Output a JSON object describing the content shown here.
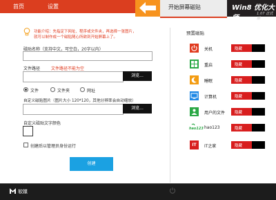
{
  "nav": {
    "home": "首页",
    "settings": "设置"
  },
  "tab": {
    "start_screen": "开始屏幕磁贴"
  },
  "product": {
    "name": "Win8 优化大师",
    "version": "1.07 正式版"
  },
  "intro": {
    "line1": "功能介绍：先指定下网址、程序或文件夹，再选择一张图片，",
    "line2": "就可以制作成一个磁贴随心所欲到开始屏幕上了。"
  },
  "form": {
    "name_label": "磁贴名称（支持中文，可空白，20字以内）",
    "name_value": "",
    "path_label": "文件路径",
    "path_error": "文件路径不能为空",
    "path_value": "",
    "browse_label": "浏览...",
    "radio_file": "文件",
    "radio_folder": "文件夹",
    "radio_url": "网址",
    "image_label": "自定义磁贴图片（图片大小 120*120，其他分辨率会自动缩放）",
    "image_value": "",
    "color_label": "自定义磁贴文字颜色",
    "admin_label": "创建后以管理员身份运行",
    "create_label": "创建"
  },
  "preset": {
    "title": "预置磁贴",
    "items": [
      {
        "label": "关机",
        "state": "隐藏",
        "icon": "power-icon",
        "color": "#e03a1e"
      },
      {
        "label": "重启",
        "state": "隐藏",
        "icon": "restart-icon",
        "color": "#2aa845"
      },
      {
        "label": "睡眠",
        "state": "隐藏",
        "icon": "sleep-icon",
        "color": "#f39c12"
      },
      {
        "label": "计算机",
        "state": "隐藏",
        "icon": "computer-icon",
        "color": "#1e88e5"
      },
      {
        "label": "用户的文件",
        "state": "隐藏",
        "icon": "user-files-icon",
        "color": "#2aa845"
      },
      {
        "label": "hao123",
        "state": "隐藏",
        "icon": "hao123-icon",
        "color": "#ffffff"
      },
      {
        "label": "IT之家",
        "state": "隐藏",
        "icon": "ithome-icon",
        "color": "#d81e1e"
      }
    ]
  },
  "footer": {
    "brand": "软媒"
  },
  "colors": {
    "accent": "#db3e1f",
    "back": "#f7931e",
    "button": "#1ba1e2"
  }
}
